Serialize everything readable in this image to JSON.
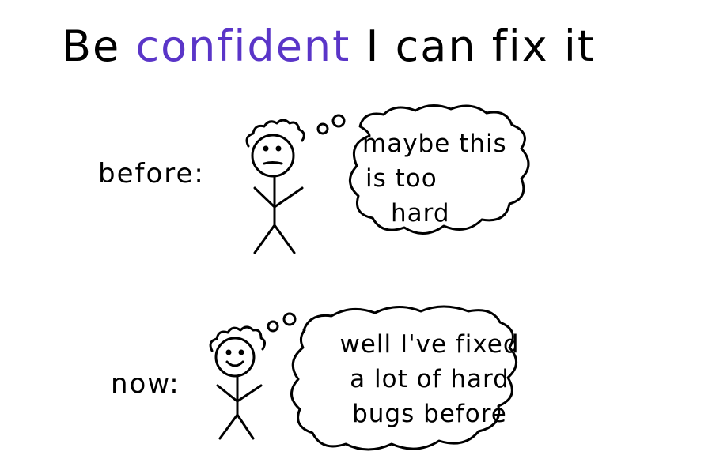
{
  "title": {
    "prefix": "Be",
    "accent": "confident",
    "suffix": "I can fix it",
    "accent_color": "#5a35c8"
  },
  "panels": [
    {
      "label": "before:",
      "face": "frown",
      "thought_lines": [
        "maybe this",
        "is too",
        "hard"
      ]
    },
    {
      "label": "now:",
      "face": "smile",
      "thought_lines": [
        "well I've fixed",
        "a lot of hard",
        "bugs before"
      ]
    }
  ]
}
